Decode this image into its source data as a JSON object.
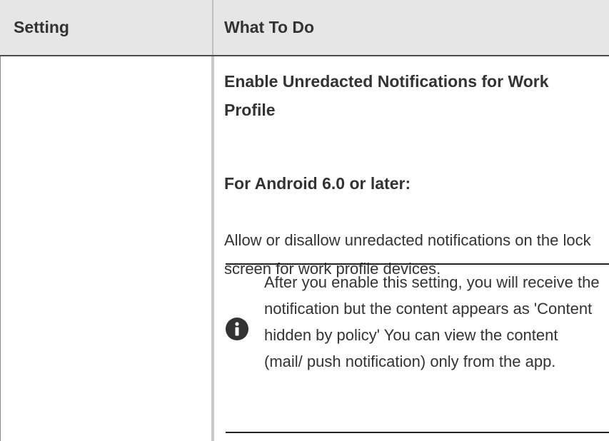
{
  "table": {
    "headers": {
      "setting": "Setting",
      "what_to_do": "What To Do"
    },
    "row": {
      "setting": "",
      "heading": "Enable Unredacted Notifications for Work Profile",
      "subheading": "For Android 6.0 or later:",
      "description": "Allow or disallow unredacted notifications on the lock screen for work profile devices.",
      "note": {
        "icon": "info-icon",
        "text": "After you enable this setting, you will receive the notification but the content appears as 'Content hidden by policy' You can view the content (mail/ push notification) only from the app."
      }
    }
  },
  "colors": {
    "header_bg": "#e6e6e6",
    "text": "#333333",
    "divider": "#c8c8c8"
  }
}
